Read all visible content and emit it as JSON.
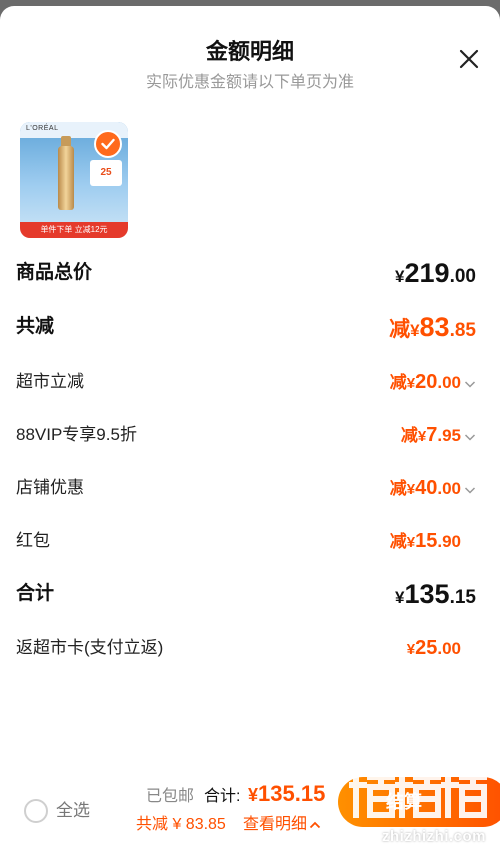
{
  "header": {
    "title": "金额明细",
    "subtitle": "实际优惠金额请以下单页为准"
  },
  "product": {
    "brand": "L'ORÉAL",
    "promo_text": "25",
    "bottom_bar_text": "单件下单 立减12元",
    "selected": true
  },
  "rows": [
    {
      "label": "商品总价",
      "prefix": "",
      "yen": "¥",
      "int": "219",
      "dec": ".00",
      "style": "bold-black",
      "chevron": false
    },
    {
      "label": "共减",
      "prefix": "减",
      "yen": "¥",
      "int": "83",
      "dec": ".85",
      "style": "bold-orange",
      "chevron": false
    },
    {
      "label": "超市立减",
      "prefix": "减",
      "yen": "¥",
      "int": "20",
      "dec": ".00",
      "style": "orange",
      "chevron": true
    },
    {
      "label": "88VIP专享9.5折",
      "prefix": "减",
      "yen": "¥",
      "int": "7",
      "dec": ".95",
      "style": "orange",
      "chevron": true
    },
    {
      "label": "店铺优惠",
      "prefix": "减",
      "yen": "¥",
      "int": "40",
      "dec": ".00",
      "style": "orange",
      "chevron": true
    },
    {
      "label": "红包",
      "prefix": "减",
      "yen": "¥",
      "int": "15",
      "dec": ".90",
      "style": "orange",
      "chevron": false
    },
    {
      "label": "合计",
      "prefix": "",
      "yen": "¥",
      "int": "135",
      "dec": ".15",
      "style": "bold-black",
      "chevron": false
    },
    {
      "label": "返超市卡(支付立返)",
      "prefix": "",
      "yen": "¥",
      "int": "25",
      "dec": ".00",
      "style": "orange",
      "chevron": false
    }
  ],
  "footer": {
    "select_all": "全选",
    "shipping": "已包邮",
    "total_label": "合计:",
    "total_yen": "¥",
    "total_value": "135.15",
    "saving_text": "共减 ¥ 83.85",
    "detail_link": "查看明细",
    "settle_label": "结算"
  },
  "watermark": {
    "site": "zhizhizhi.com"
  },
  "colors": {
    "accent": "#ff5000",
    "accent_gradient_start": "#ff9000",
    "muted": "#999999"
  },
  "icons": [
    "close-icon",
    "check-icon",
    "chevron-down-icon",
    "chevron-up-icon",
    "radio-icon"
  ]
}
